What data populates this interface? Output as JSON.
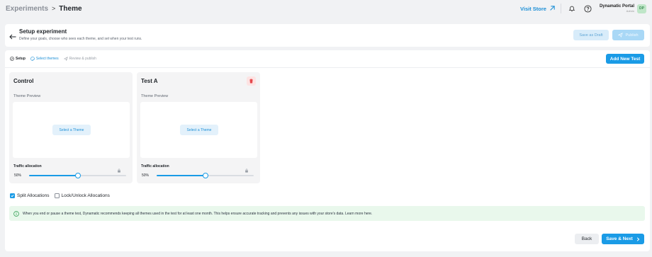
{
  "breadcrumb": {
    "root": "Experiments",
    "separator": ">",
    "current": "Theme"
  },
  "topbar": {
    "visit_store": "Visit Store",
    "user_name": "Dynamatic Portal",
    "user_role": "Admin",
    "avatar_initials": "DP"
  },
  "header": {
    "title": "Setup experiment",
    "subtitle": "Define your goals, choose who sees each theme, and set when your test runs.",
    "save_draft": "Save as Draft",
    "publish": "Publish"
  },
  "steps": [
    {
      "label": "Setup",
      "state": "done",
      "icon": "check-circle-icon"
    },
    {
      "label": "Select themes",
      "state": "current",
      "icon": "palette-icon"
    },
    {
      "label": "Review & publish",
      "state": "upcoming",
      "icon": "send-icon"
    }
  ],
  "add_test": "Add New Test",
  "tests": [
    {
      "name": "Control",
      "preview_label": "Theme Preview",
      "select_label": "Select a Theme",
      "traffic_label": "Traffic allocation",
      "traffic_value": "50%",
      "traffic_fraction": 0.5,
      "deletable": false
    },
    {
      "name": "Test A",
      "preview_label": "Theme Preview",
      "select_label": "Select a Theme",
      "traffic_label": "Traffic allocation",
      "traffic_value": "50%",
      "traffic_fraction": 0.5,
      "deletable": true
    }
  ],
  "options": {
    "split": {
      "label": "Split Allocations",
      "checked": true
    },
    "lock": {
      "label": "Lock/Unlock Allocations",
      "checked": false
    }
  },
  "notice": "When you end or pause a theme test, Dynamatic recommends keeping all themes used in the test for at least one month. This helps ensure accurate tracking and prevents any issues with your store's data. Learn more here.",
  "footer": {
    "back": "Back",
    "next": "Save & Next"
  },
  "colors": {
    "primary": "#1a9be6",
    "notice_bg": "#e9f8ec",
    "danger": "#e5484d"
  }
}
